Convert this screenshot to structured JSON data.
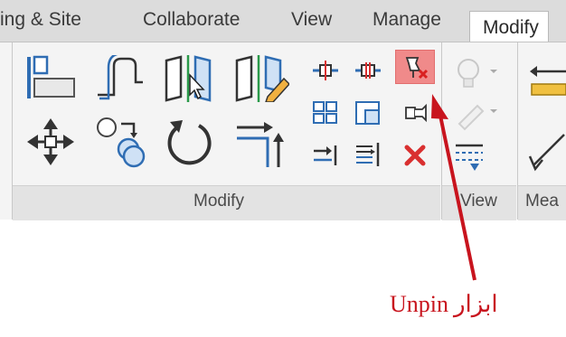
{
  "tabs": [
    {
      "label": "ing & Site",
      "active": false
    },
    {
      "label": "Collaborate",
      "active": false
    },
    {
      "label": "View",
      "active": false
    },
    {
      "label": "Manage",
      "active": false
    },
    {
      "label": "Modify",
      "active": true
    }
  ],
  "panels": {
    "modify": {
      "title": "Modify"
    },
    "view": {
      "title": "View"
    },
    "measure": {
      "title": "Mea"
    }
  },
  "icons": [
    "align-icon",
    "offset-icon",
    "mirror-pick-axis-icon",
    "mirror-draw-axis-icon",
    "split-element-icon",
    "split-with-gap-icon",
    "unpin-icon",
    "move-icon",
    "copy-icon",
    "rotate-icon",
    "trim-extend-corner-icon",
    "array-icon",
    "scale-icon",
    "pin-icon",
    "trim-extend-single-icon",
    "trim-extend-multiple-icon",
    "delete-icon",
    "hide-bulb-icon",
    "override-graphics-icon",
    "linework-icon",
    "aligned-dimension-icon",
    "measure-icon"
  ],
  "colors": {
    "highlight": "#f08a8a",
    "annotation": "#c8141e",
    "delete": "#d93030",
    "icon_blue": "#2f6db3"
  },
  "annotation": {
    "text": "Unpin",
    "text_persian": "ابزار"
  }
}
